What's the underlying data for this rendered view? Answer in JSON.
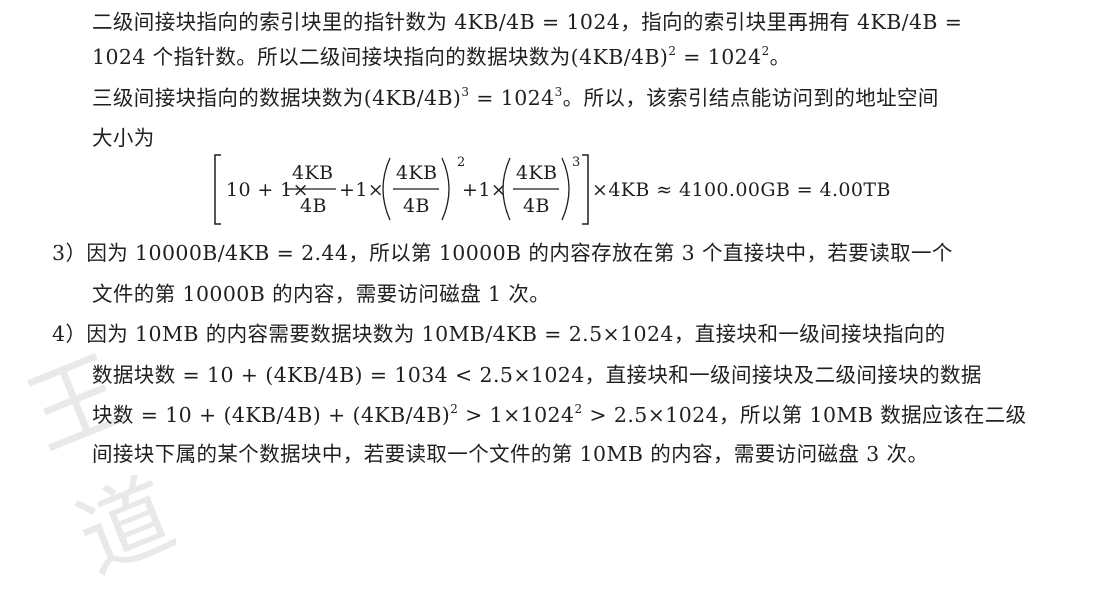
{
  "watermark": "王道",
  "para2": {
    "line1": "二级间接块指向的索引块里的指针数为 4KB/4B = 1024，指向的索引块里再拥有 4KB/4B =",
    "line2_a": "1024 个指针数。所以二级间接块指向的数据块数为(4KB/4B)",
    "line2_sup1": "2",
    "line2_b": " = 1024",
    "line2_sup2": "2",
    "line2_c": "。",
    "line3_a": "三级间接块指向的数据块数为(4KB/4B)",
    "line3_sup1": "3",
    "line3_b": " = 1024",
    "line3_sup2": "3",
    "line3_c": "。所以，该索引结点能访问到的地址空间",
    "line4": "大小为"
  },
  "formula": {
    "start": "10 + 1×",
    "frac1_num": "4KB",
    "frac1_den": "4B",
    "mid1": "+1×",
    "frac2_num": "4KB",
    "frac2_den": "4B",
    "exp2": "2",
    "mid2": "+1×",
    "frac3_num": "4KB",
    "frac3_den": "4B",
    "exp3": "3",
    "tail": "×4KB ≈ 4100.00GB = 4.00TB"
  },
  "item3": {
    "number": "3）",
    "line1": "因为 10000B/4KB = 2.44，所以第 10000B 的内容存放在第 3 个直接块中，若要读取一个",
    "line2": "文件的第 10000B 的内容，需要访问磁盘 1 次。"
  },
  "item4": {
    "number": "4）",
    "line1": "因为 10MB 的内容需要数据块数为 10MB/4KB = 2.5×1024，直接块和一级间接块指向的",
    "line2": "数据块数 = 10 + (4KB/4B) = 1034 < 2.5×1024，直接块和一级间接块及二级间接块的数据",
    "line3_a": "块数 = 10 + (4KB/4B) + (4KB/4B)",
    "line3_sup1": "2",
    "line3_b": " > 1×1024",
    "line3_sup2": "2",
    "line3_c": " > 2.5×1024，所以第 10MB 数据应该在二级",
    "line4": "间接块下属的某个数据块中，若要读取一个文件的第 10MB 的内容，需要访问磁盘 3 次。"
  }
}
